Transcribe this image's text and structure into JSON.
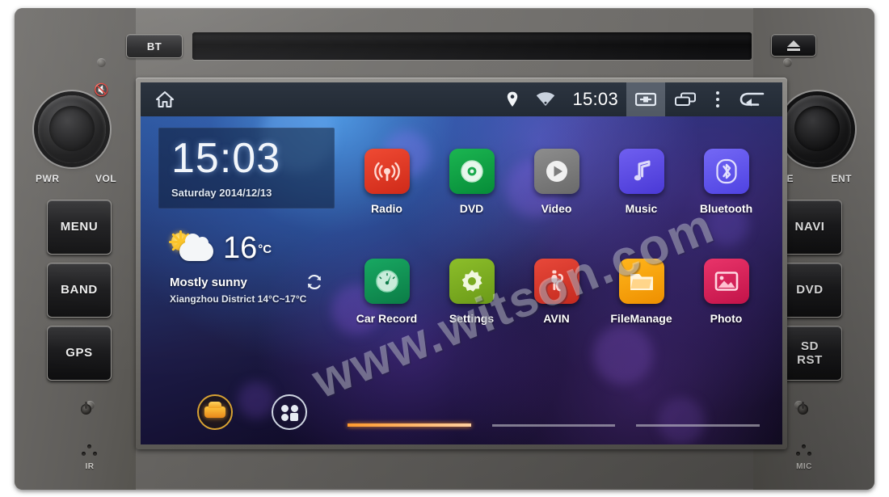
{
  "device": {
    "top_bar": {
      "bt_label": "BT",
      "eject_icon": "eject-icon"
    },
    "left_controls": {
      "knob_labels": {
        "left": "PWR",
        "right": "VOL"
      },
      "mute_icon": "mute-icon",
      "buttons": [
        {
          "label": "MENU",
          "name": "menu-button"
        },
        {
          "label": "BAND",
          "name": "band-button"
        },
        {
          "label": "GPS",
          "name": "gps-button"
        }
      ],
      "sensor": {
        "label": "IR",
        "icon": "ir-sensor-icon"
      }
    },
    "right_controls": {
      "knob_labels": {
        "left": "TUNE",
        "right": "ENT"
      },
      "buttons": [
        {
          "label": "NAVI",
          "name": "navi-button"
        },
        {
          "label": "DVD",
          "name": "dvd-button"
        },
        {
          "label": "SD\nRST",
          "line1": "SD",
          "line2": "RST",
          "name": "sd-rst-button"
        }
      ],
      "sensor": {
        "label": "MIC",
        "icon": "mic-icon"
      }
    }
  },
  "screen": {
    "statusbar": {
      "home_icon": "home-icon",
      "location_icon": "location-pin-icon",
      "wifi_icon": "wifi-icon",
      "time": "15:03",
      "screenshot_icon": "screenshot-icon",
      "recents_icon": "recent-apps-icon",
      "overflow_icon": "overflow-menu-icon",
      "back_icon": "back-icon"
    },
    "clock_widget": {
      "time": "15:03",
      "date": "Saturday 2014/12/13"
    },
    "weather_widget": {
      "temperature": "16",
      "unit": "°C",
      "condition": "Mostly sunny",
      "location_range": "Xiangzhou District 14°C~17°C",
      "weather_icon": "sun-behind-cloud-icon",
      "refresh_icon": "refresh-icon"
    },
    "dock": [
      {
        "name": "car-shortcut",
        "icon": "car-icon"
      },
      {
        "name": "app-drawer-shortcut",
        "icon": "app-drawer-icon"
      }
    ],
    "apps": [
      [
        {
          "label": "Radio",
          "icon": "radio-icon",
          "color": "#e03725"
        },
        {
          "label": "DVD",
          "icon": "disc-icon",
          "color": "#14a245"
        },
        {
          "label": "Video",
          "icon": "play-icon",
          "color": "#7d7d7d"
        },
        {
          "label": "Music",
          "icon": "music-note-icon",
          "color": "#5b4ae8"
        },
        {
          "label": "Bluetooth",
          "icon": "bluetooth-icon",
          "color": "#6257ea"
        }
      ],
      [
        {
          "label": "Car Record",
          "icon": "gauge-icon",
          "color": "#119456"
        },
        {
          "label": "Settings",
          "icon": "gear-icon",
          "color": "#7aab22"
        },
        {
          "label": "AVIN",
          "icon": "av-input-icon",
          "color": "#d93a2b"
        },
        {
          "label": "FileManage",
          "icon": "folder-icon",
          "color": "#f59f05"
        },
        {
          "label": "Photo",
          "icon": "picture-icon",
          "color": "#d8265a"
        }
      ]
    ],
    "page_indicator": {
      "pages": 3,
      "active": 1,
      "active_color": "#ff9a2e"
    }
  },
  "watermark": {
    "text": "www.witson.com"
  }
}
